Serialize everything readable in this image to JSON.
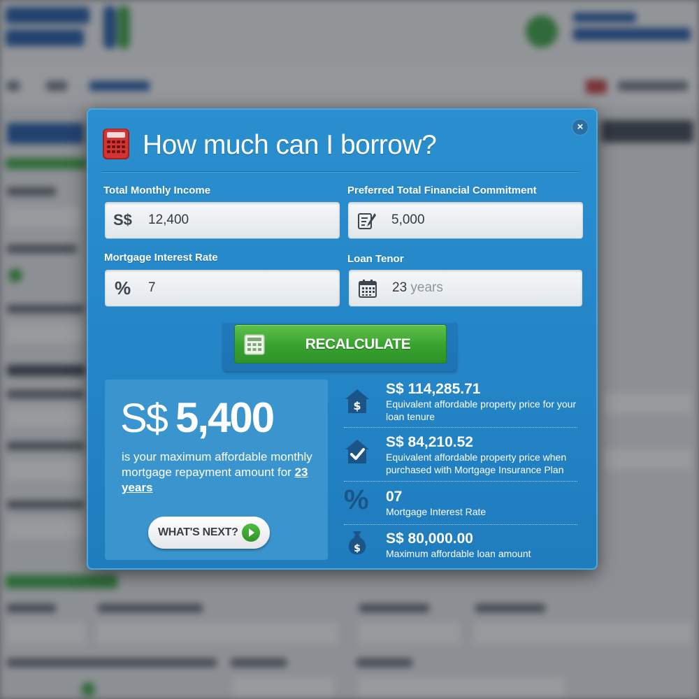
{
  "modal": {
    "title": "How much can I borrow?",
    "close_label": "×"
  },
  "fields": {
    "income": {
      "label": "Total Monthly Income",
      "prefix": "S$",
      "value": "12,400"
    },
    "commitment": {
      "label": "Preferred Total Financial Commitment",
      "value": "5,000"
    },
    "interest": {
      "label": "Mortgage Interest Rate",
      "prefix": "%",
      "value": "7"
    },
    "tenor": {
      "label": "Loan Tenor",
      "value": "23",
      "suffix": "years"
    }
  },
  "recalculate": {
    "label": "RECALCULATE"
  },
  "summary": {
    "currency": "S$",
    "amount": "5,400",
    "text": "is your maximum affordable monthly mortgage repayment amount for",
    "years_link": "23 years",
    "whats_next_label": "WHAT'S NEXT?"
  },
  "results": [
    {
      "icon": "house-dollar-icon",
      "value": "S$ 114,285.71",
      "desc": "Equivalent affordable property price for your loan tenure"
    },
    {
      "icon": "house-check-icon",
      "value": "S$ 84,210.52",
      "desc": "Equivalent affordable property price when purchased with Mortgage Insurance Plan"
    },
    {
      "icon": "percent-icon",
      "value": "07",
      "desc": "Mortgage Interest Rate"
    },
    {
      "icon": "money-bag-icon",
      "value": "S$ 80,000.00",
      "desc": "Maximum affordable loan amount"
    }
  ],
  "colors": {
    "modal_blue": "#2384c6",
    "button_green": "#37a22f",
    "icon_navy": "#1b5487",
    "calculator_red": "#c82a2a"
  }
}
